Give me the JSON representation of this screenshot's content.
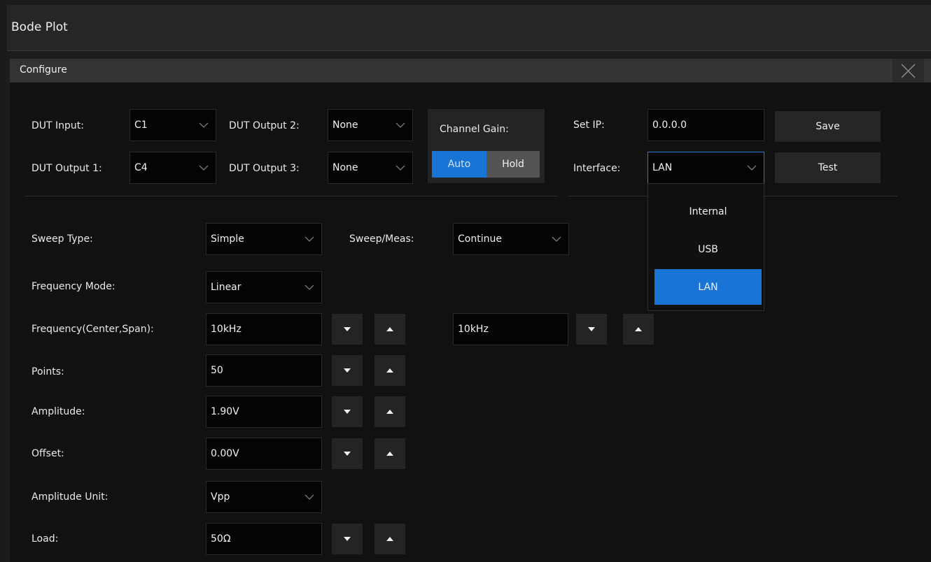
{
  "window": {
    "title": "Bode Plot"
  },
  "dialog": {
    "title": "Configure"
  },
  "dut": {
    "input_label": "DUT Input:",
    "input_value": "C1",
    "output1_label": "DUT Output 1:",
    "output1_value": "C4",
    "output2_label": "DUT Output 2:",
    "output2_value": "None",
    "output3_label": "DUT Output 3:",
    "output3_value": "None"
  },
  "channel_gain": {
    "label": "Channel Gain:",
    "auto": "Auto",
    "hold": "Hold",
    "selected": "Auto"
  },
  "network": {
    "ip_label": "Set IP:",
    "ip_value": "0.0.0.0",
    "save": "Save",
    "interface_label": "Interface:",
    "interface_value": "LAN",
    "test": "Test",
    "interface_options": [
      "Internal",
      "USB",
      "LAN"
    ]
  },
  "sweep": {
    "type_label": "Sweep Type:",
    "type_value": "Simple",
    "meas_label": "Sweep/Meas:",
    "meas_value": "Continue",
    "freq_mode_label": "Frequency Mode:",
    "freq_mode_value": "Linear",
    "freq_label": "Frequency(Center,Span):",
    "freq_center": "10kHz",
    "freq_span": "10kHz",
    "points_label": "Points:",
    "points_value": "50",
    "amplitude_label": "Amplitude:",
    "amplitude_value": "1.90V",
    "offset_label": "Offset:",
    "offset_value": "0.00V",
    "amp_unit_label": "Amplitude Unit:",
    "amp_unit_value": "Vpp",
    "load_label": "Load:",
    "load_value": "50Ω"
  },
  "colors": {
    "accent": "#1a74d6",
    "background": "#111111",
    "field": "#040404",
    "button": "#262626"
  },
  "icons": {
    "close": "close-icon",
    "dropdown": "chevron-down-icon",
    "decrease": "triangle-down-icon",
    "increase": "triangle-up-icon"
  }
}
